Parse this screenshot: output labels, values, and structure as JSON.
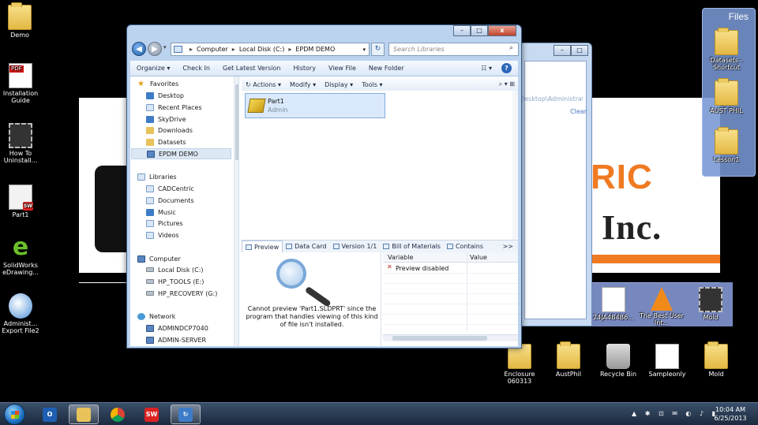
{
  "desktop": {
    "left_icons": [
      {
        "label": "Demo"
      },
      {
        "label": "Installation Guide"
      },
      {
        "label": "How To Uninstall..."
      },
      {
        "label": "Part1"
      },
      {
        "label": "SolidWorks eDrawing..."
      },
      {
        "label": "Administ... Export File2"
      }
    ],
    "files_panel": {
      "title": "Files",
      "items": [
        {
          "label": "Datasets - Shortcut"
        },
        {
          "label": "AUST PHIL"
        },
        {
          "label": "Lesson1"
        }
      ]
    },
    "shelf_top_items": [
      {
        "label": "24JA4B4B6..."
      },
      {
        "label": "The Best User Int..."
      },
      {
        "label": "Mold"
      }
    ],
    "bottom_icons": [
      {
        "label": "Enclosure 060313"
      },
      {
        "label": "AustPhil"
      },
      {
        "label": "Recycle Bin"
      },
      {
        "label": "Sampleonly"
      },
      {
        "label": "Mold"
      }
    ],
    "wallpaper": {
      "text_ric": "RIC",
      "text_inc": "Inc."
    }
  },
  "bg_window": {
    "path": "Desktop\\Administrativ...",
    "clear_label": "Clear"
  },
  "explorer": {
    "window_buttons": {
      "minimize": "–",
      "maximize": "□",
      "close": "x"
    },
    "breadcrumb": [
      "Computer",
      "Local Disk (C:)",
      "EPDM DEMO"
    ],
    "search_placeholder": "Search Libraries",
    "commands": {
      "organize": "Organize ▾",
      "check_in": "Check In",
      "get_latest": "Get Latest Version",
      "history": "History",
      "view_file": "View File",
      "new_folder": "New Folder"
    },
    "nav": {
      "favorites": "Favorites",
      "favorites_items": [
        "Desktop",
        "Recent Places",
        "SkyDrive",
        "Downloads",
        "Datasets",
        "EPDM DEMO"
      ],
      "libraries": "Libraries",
      "libraries_items": [
        "CADCentric",
        "Documents",
        "Music",
        "Pictures",
        "Videos"
      ],
      "computer": "Computer",
      "computer_items": [
        "Local Disk (C:)",
        "HP_TOOLS (E:)",
        "HP_RECOVERY (G:)"
      ],
      "network": "Network",
      "network_items": [
        "ADMINDCP7040",
        "ADMIN-SERVER"
      ]
    },
    "pdm_menu": [
      "Actions",
      "Modify",
      "Display",
      "Tools"
    ],
    "file": {
      "name": "Part1",
      "owner": "Admin"
    },
    "tabs": [
      "Preview",
      "Data Card",
      "Version 1/1",
      "Bill of Materials",
      "Contains"
    ],
    "tabs_more": ">>",
    "preview_message": "Cannot preview 'Part1.SLDPRT' since the program that handles viewing of this kind of file isn't installed.",
    "variables": {
      "col_variable": "Variable",
      "col_value": "Value",
      "row1": "Preview disabled"
    }
  },
  "taskbar": {
    "clock_time": "10:04 AM",
    "clock_date": "6/25/2013",
    "apps": [
      "outlook-icon",
      "explorer-icon",
      "chrome-icon",
      "solidworks-icon",
      "pdm-icon"
    ]
  }
}
